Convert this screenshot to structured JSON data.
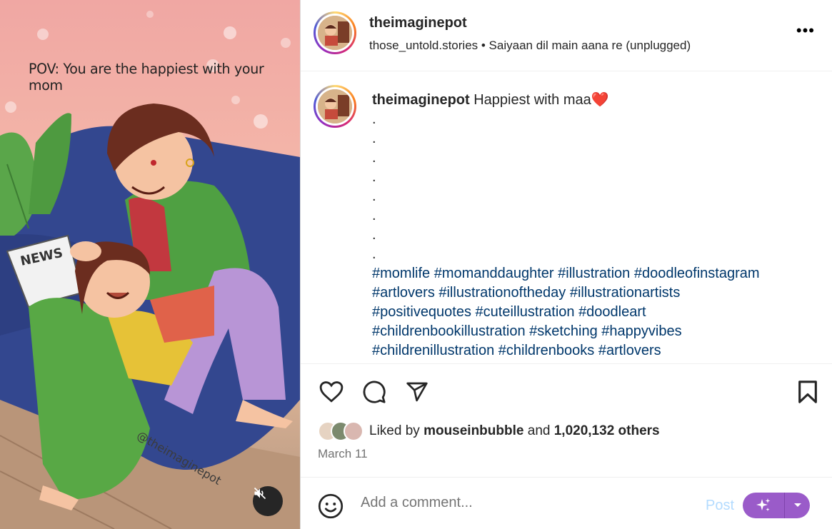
{
  "media": {
    "overlay_text": "POV: You are the happiest with your mom",
    "watermark": "@theimaginepot",
    "newspaper_text": "NEWS",
    "mute_icon": "speaker-muted-icon"
  },
  "header": {
    "username": "theimaginepot",
    "audio": "those_untold.stories • Saiyaan dil main aana re (unplugged)",
    "more_icon": "more-horizontal-icon"
  },
  "caption": {
    "username": "theimaginepot",
    "text": "Happiest with maa",
    "emoji": "❤️",
    "dots": [
      ".",
      ".",
      ".",
      ".",
      ".",
      ".",
      ".",
      "."
    ],
    "hashtags_lines": [
      "#momlife #momanddaughter #illustration #doodleofinstagram",
      "#artlovers #illustrationoftheday #illustrationartists",
      "#positivequotes #cuteillustration #doodleart",
      "#childrenbookillustration #sketching #happyvibes",
      "#childrenillustration #childrenbooks #artlovers"
    ]
  },
  "actions": {
    "like_icon": "heart-icon",
    "comment_icon": "comment-icon",
    "share_icon": "send-icon",
    "save_icon": "bookmark-icon"
  },
  "likes": {
    "prefix": "Liked by",
    "user": "mouseinbubble",
    "middle": "and",
    "count": "1,020,132 others"
  },
  "date": "March 11",
  "comment": {
    "placeholder": "Add a comment...",
    "post_label": "Post",
    "emoji_icon": "smiley-icon",
    "ai_icon": "sparkles-icon",
    "dropdown_icon": "chevron-down-icon"
  },
  "colors": {
    "hashtag": "#00376b",
    "post_disabled": "#b3dbff",
    "ai_button": "#9a5bc9",
    "muted_text": "#737373"
  }
}
